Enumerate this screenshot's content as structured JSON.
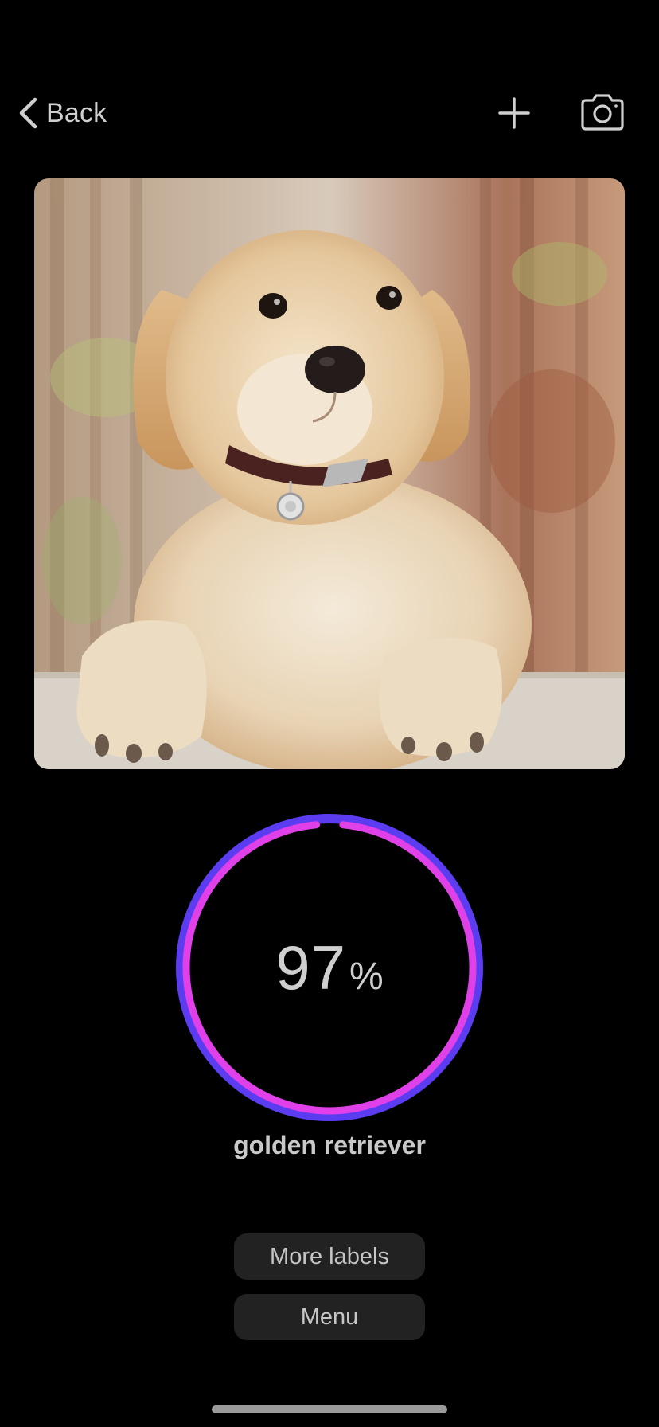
{
  "nav": {
    "back_label": "Back",
    "back_icon": "chevron-left-icon",
    "add_icon": "plus-icon",
    "camera_icon": "camera-icon"
  },
  "photo": {
    "subject": "golden retriever puppy photo"
  },
  "result": {
    "confidence_value": "97",
    "confidence_unit": "%",
    "confidence_fraction": 0.97,
    "label": "golden retriever",
    "ring_colors": {
      "outer": "#5b3cf0",
      "inner": "#e040e8"
    }
  },
  "buttons": {
    "more_labels": "More labels",
    "menu": "Menu"
  },
  "colors": {
    "background": "#000000",
    "button_bg": "#222222",
    "text": "#cfcfcf"
  }
}
